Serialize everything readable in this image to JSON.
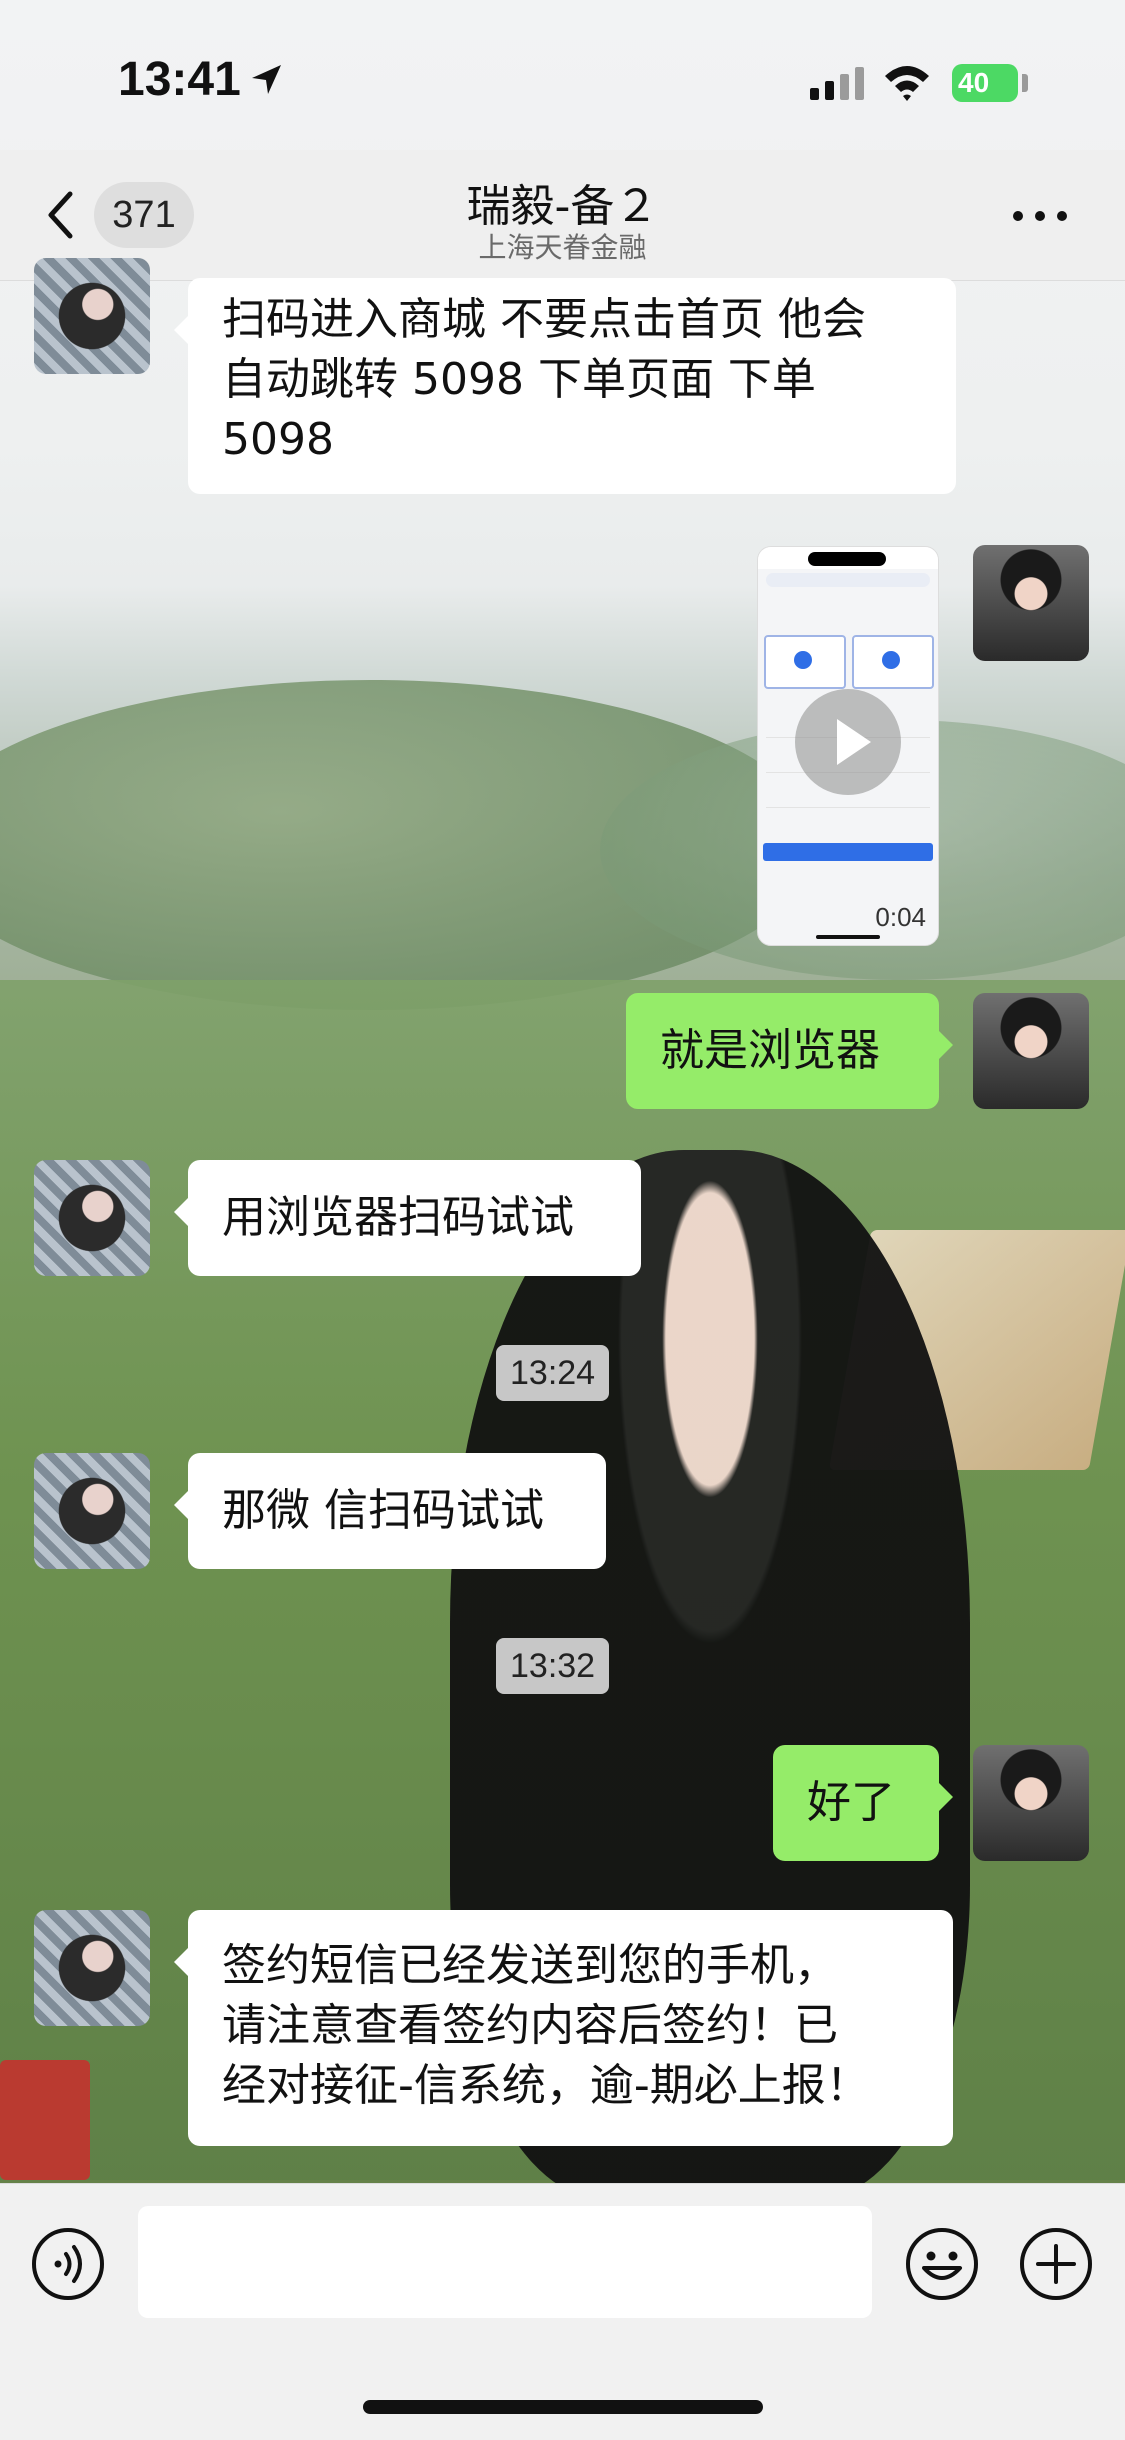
{
  "status_bar": {
    "time": "13:41",
    "battery": "40"
  },
  "nav": {
    "unread_count": "371",
    "title": "瑞毅-备２",
    "subtitle": "上海天眷金融"
  },
  "messages": [
    {
      "side": "left",
      "type": "text",
      "text_lines": [
        "扫码进入商城 不要点击首页 他会",
        "自动跳转 5098 下单页面 下单",
        "5098"
      ]
    },
    {
      "side": "right",
      "type": "video",
      "duration": "0:04"
    },
    {
      "side": "right",
      "type": "text",
      "text": "就是浏览器"
    },
    {
      "side": "left",
      "type": "text",
      "text": "用浏览器扫码试试"
    },
    {
      "type": "timestamp",
      "text": "13:24"
    },
    {
      "side": "left",
      "type": "text",
      "text": "那微 信扫码试试"
    },
    {
      "type": "timestamp",
      "text": "13:32"
    },
    {
      "side": "right",
      "type": "text",
      "text": "好了"
    },
    {
      "side": "left",
      "type": "text",
      "text_lines": [
        "签约短信已经发送到您的手机，",
        "请注意查看签约内容后签约！已",
        "经对接征-信系统，逾-期必上报！"
      ]
    }
  ],
  "input": {
    "value": ""
  },
  "icons": {
    "location": "location-arrow-icon",
    "signal": "cellular-signal-icon",
    "wifi": "wifi-icon",
    "back": "chevron-left-icon",
    "more": "more-dots-icon",
    "voice": "voice-input-icon",
    "emoji": "emoji-icon",
    "plus": "plus-icon",
    "play": "play-icon"
  },
  "colors": {
    "sent_bubble": "#95ec69",
    "received_bubble": "#ffffff",
    "battery": "#4cd964"
  }
}
